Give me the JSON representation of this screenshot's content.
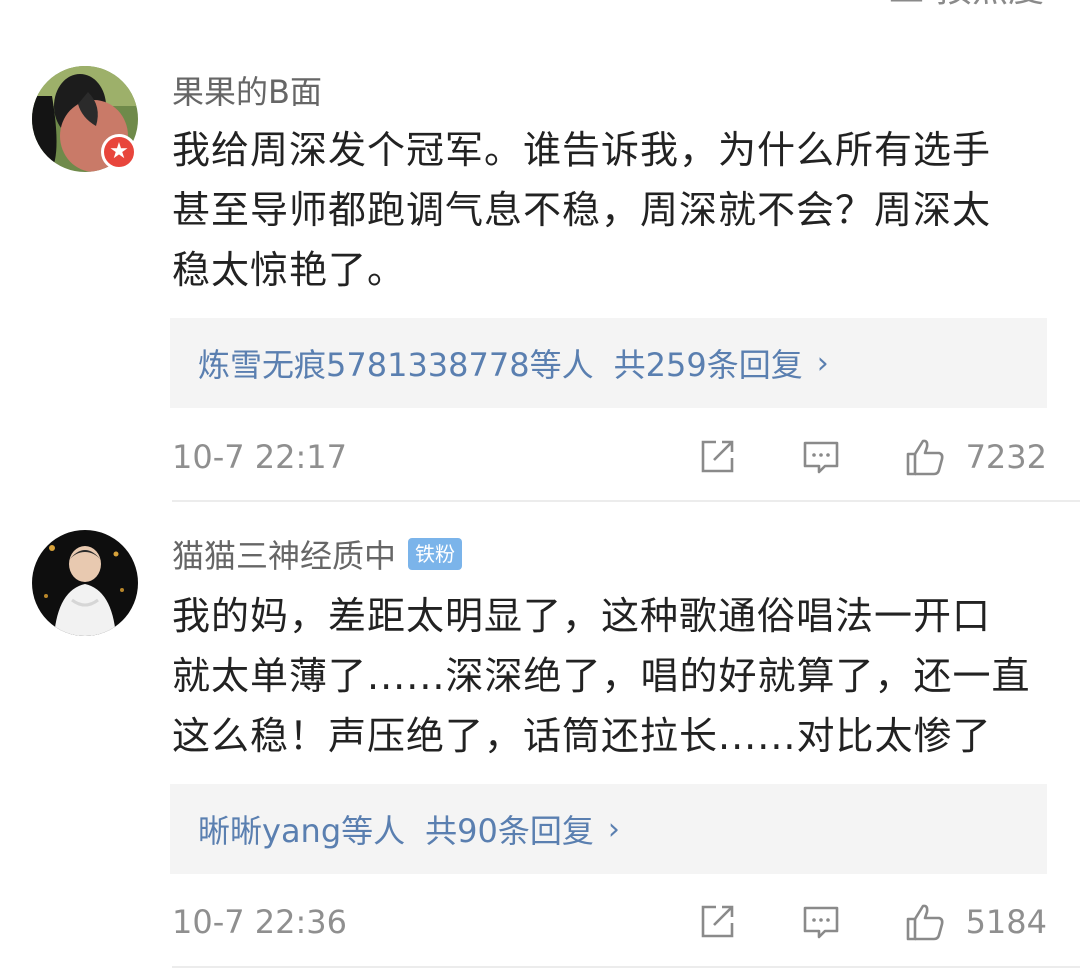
{
  "header": {
    "sort_label": "三 按热度"
  },
  "comments": [
    {
      "username": "果果的B面",
      "fan_badge": "",
      "text_lines": [
        "我给周深发个冠军。谁告诉我，为什么所有选手",
        "甚至导师都跑调气息不稳，周深就不会？周深太",
        "稳太惊艳了。"
      ],
      "reply_users": "炼雪无痕5781338778等人",
      "reply_total": "共259条回复",
      "reply_chevron": "›",
      "timestamp": "10-7 22:17",
      "likes": "7232"
    },
    {
      "username": "猫猫三神经质中",
      "fan_badge": "铁粉",
      "text_lines": [
        "我的妈，差距太明显了，这种歌通俗唱法一开口",
        "就太单薄了......深深绝了，唱的好就算了，还一直",
        "这么稳！声压绝了，话筒还拉长......对比太惨了"
      ],
      "reply_users": "晰晰yang等人",
      "reply_total": "共90条回复",
      "reply_chevron": "›",
      "timestamp": "10-7 22:36",
      "likes": "5184"
    }
  ],
  "icons": {
    "repost": "share-icon",
    "comment": "comment-icon",
    "like": "thumbs-up-icon",
    "verified": "verified-badge-icon"
  },
  "colors": {
    "reply_link": "#5a7fb0",
    "fan_badge": "#7bb4ea",
    "verified_badge": "#e8453c"
  }
}
